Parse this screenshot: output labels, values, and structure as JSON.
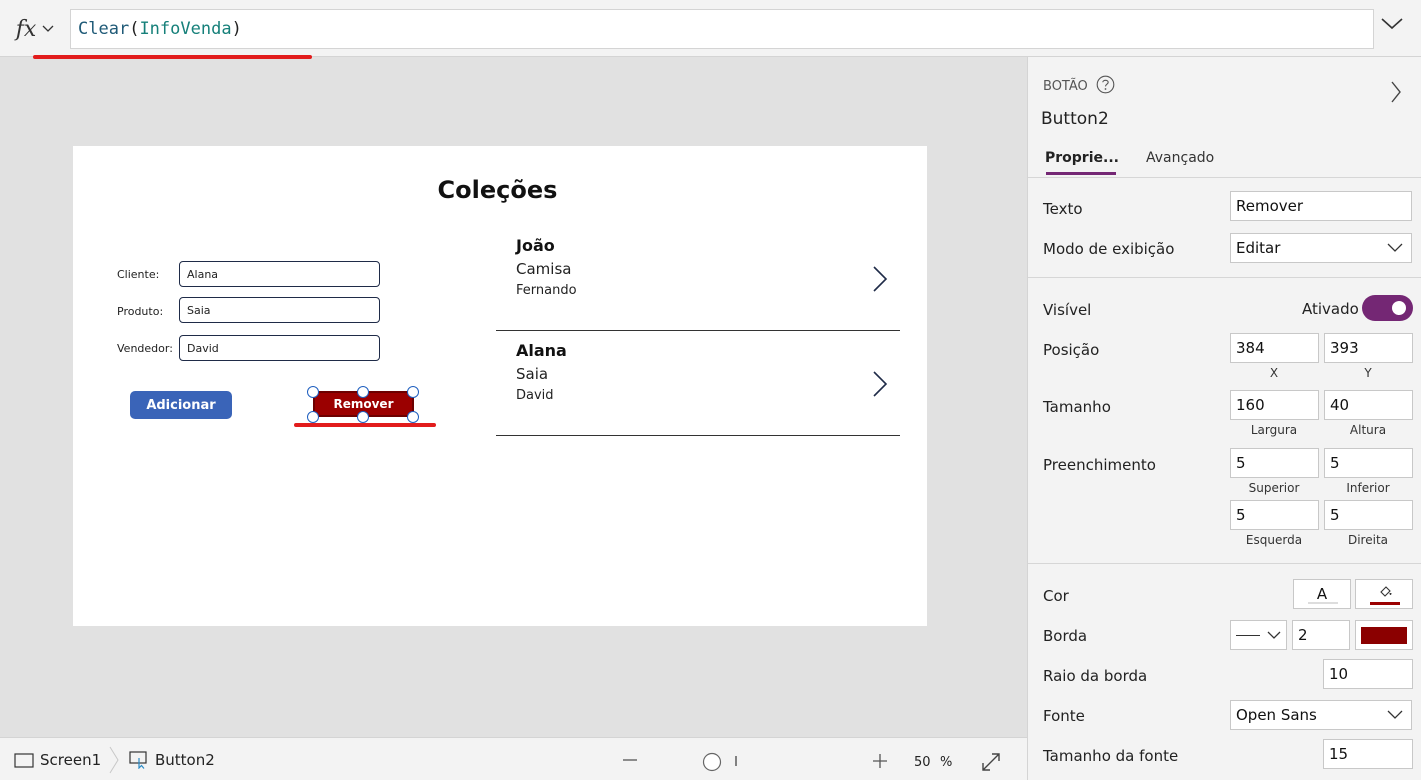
{
  "formula": {
    "fx_label": "fx",
    "func": "Clear",
    "paren_open": "(",
    "arg": "InfoVenda",
    "paren_close": ")"
  },
  "canvas": {
    "title": "Coleções",
    "form": {
      "cliente_label": "Cliente:",
      "cliente_value": "Alana",
      "produto_label": "Produto:",
      "produto_value": "Saia",
      "vendedor_label": "Vendedor:",
      "vendedor_value": "David"
    },
    "buttons": {
      "adicionar": "Adicionar",
      "remover": "Remover"
    },
    "gallery": [
      {
        "cliente": "João",
        "produto": "Camisa",
        "vendedor": "Fernando"
      },
      {
        "cliente": "Alana",
        "produto": "Saia",
        "vendedor": "David"
      }
    ]
  },
  "status": {
    "screen": "Screen1",
    "control": "Button2",
    "zoom_value": "50",
    "zoom_unit": "%"
  },
  "panel": {
    "type": "BOTÃO",
    "name": "Button2",
    "tabs": [
      "Proprie...",
      "Avançado"
    ],
    "texto_label": "Texto",
    "texto_value": "Remover",
    "modo_label": "Modo de exibição",
    "modo_value": "Editar",
    "visivel_label": "Visível",
    "visivel_value": "Ativado",
    "posicao_label": "Posição",
    "pos_x": "384",
    "pos_y": "393",
    "pos_x_caption": "X",
    "pos_y_caption": "Y",
    "tamanho_label": "Tamanho",
    "largura": "160",
    "altura": "40",
    "largura_caption": "Largura",
    "altura_caption": "Altura",
    "preenchimento_label": "Preenchimento",
    "superior": "5",
    "inferior": "5",
    "esquerda": "5",
    "direita": "5",
    "superior_caption": "Superior",
    "inferior_caption": "Inferior",
    "esquerda_caption": "Esquerda",
    "direita_caption": "Direita",
    "cor_label": "Cor",
    "cor_text_glyph": "A",
    "borda_label": "Borda",
    "borda_width": "2",
    "border_color": "#8b0000",
    "raio_label": "Raio da borda",
    "raio_value": "10",
    "fonte_label": "Fonte",
    "fonte_value": "Open Sans",
    "tamanho_fonte_label": "Tamanho da fonte",
    "tamanho_fonte_value": "15",
    "accent_color": "#742774"
  }
}
